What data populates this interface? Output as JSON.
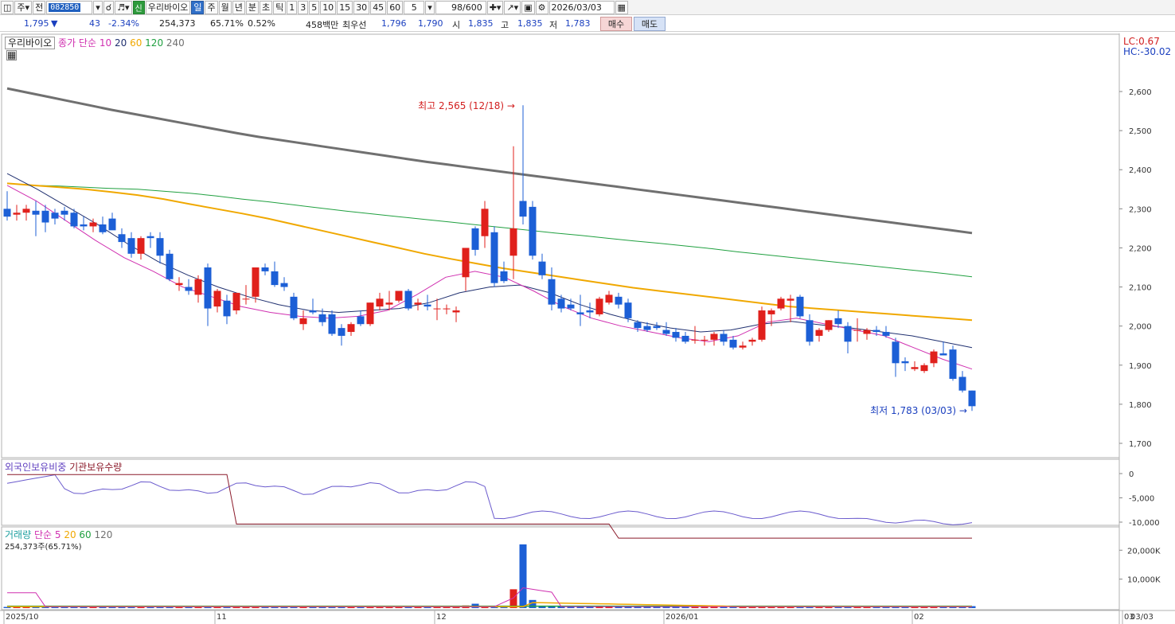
{
  "toolbar": {
    "market": "주",
    "kind": "전",
    "code": "082850",
    "badge": "신",
    "name": "우리바이오",
    "periods": [
      "일",
      "주",
      "월",
      "년",
      "분",
      "초",
      "틱"
    ],
    "active_period": "일",
    "minutes": [
      "1",
      "3",
      "5",
      "10",
      "15",
      "30",
      "45",
      "60"
    ],
    "interval": "5",
    "count": "98/600",
    "date": "2026/03/03"
  },
  "quote": {
    "price": "1,795",
    "arrow": "▼",
    "change": "43",
    "change_pct": "-2.34%",
    "volume": "254,373",
    "vol_ratio": "65.71%",
    "turnover": "0.52%",
    "amount": "458백만",
    "best_label": "최우선",
    "best_ask": "1,796",
    "best_bid": "1,790",
    "open_label": "시",
    "open": "1,835",
    "high_label": "고",
    "high": "1,835",
    "low_label": "저",
    "low": "1,783",
    "buy_label": "매수",
    "sell_label": "매도"
  },
  "price_panel": {
    "stock_label": "우리바이오",
    "ma_label": "종가 단순",
    "ma_periods": [
      "10",
      "20",
      "60",
      "120",
      "240"
    ],
    "lc_label": "LC:0.67",
    "hc_label": "HC:-30.02",
    "max_annotation": "최고 2,565 (12/18)",
    "min_annotation": "최저 1,783 (03/03)",
    "y_ticks": [
      "2,600",
      "2,500",
      "2,400",
      "2,300",
      "2,200",
      "2,100",
      "2,000",
      "1,900",
      "1,800",
      "1,700"
    ]
  },
  "foreign_panel": {
    "label1": "외국인보유비중",
    "label2": "기관보유수량",
    "y_ticks": [
      "0",
      "-5,000",
      "-10,000"
    ]
  },
  "volume_panel": {
    "label": "거래량",
    "ma_label": "단순 5",
    "ma_periods": [
      "20",
      "60",
      "120"
    ],
    "current": "254,373주(65.71%)",
    "y_ticks": [
      "20,000K",
      "10,000K"
    ]
  },
  "x_axis": {
    "labels": [
      "2025/10",
      "11",
      "12",
      "2026/01",
      "02",
      "03"
    ],
    "right_label": "03/03"
  },
  "colors": {
    "up": "#e0201c",
    "down": "#1c5fd6",
    "ma10": "#d030b0",
    "ma20": "#203070",
    "ma60": "#f0a800",
    "ma120": "#20a040",
    "ma240": "#707070"
  },
  "chart_data": {
    "type": "candlestick",
    "candles": [
      {
        "o": 2300,
        "h": 2345,
        "l": 2270,
        "c": 2280
      },
      {
        "o": 2285,
        "h": 2310,
        "l": 2270,
        "c": 2290
      },
      {
        "o": 2290,
        "h": 2310,
        "l": 2270,
        "c": 2300
      },
      {
        "o": 2295,
        "h": 2320,
        "l": 2230,
        "c": 2285
      },
      {
        "o": 2295,
        "h": 2310,
        "l": 2240,
        "c": 2265
      },
      {
        "o": 2290,
        "h": 2300,
        "l": 2260,
        "c": 2275
      },
      {
        "o": 2295,
        "h": 2305,
        "l": 2270,
        "c": 2285
      },
      {
        "o": 2290,
        "h": 2300,
        "l": 2250,
        "c": 2255
      },
      {
        "o": 2260,
        "h": 2280,
        "l": 2245,
        "c": 2255
      },
      {
        "o": 2255,
        "h": 2275,
        "l": 2240,
        "c": 2265
      },
      {
        "o": 2260,
        "h": 2280,
        "l": 2235,
        "c": 2240
      },
      {
        "o": 2275,
        "h": 2290,
        "l": 2260,
        "c": 2245
      },
      {
        "o": 2235,
        "h": 2250,
        "l": 2200,
        "c": 2215
      },
      {
        "o": 2225,
        "h": 2240,
        "l": 2175,
        "c": 2185
      },
      {
        "o": 2185,
        "h": 2230,
        "l": 2170,
        "c": 2225
      },
      {
        "o": 2230,
        "h": 2240,
        "l": 2200,
        "c": 2225
      },
      {
        "o": 2225,
        "h": 2240,
        "l": 2160,
        "c": 2180
      },
      {
        "o": 2185,
        "h": 2195,
        "l": 2115,
        "c": 2120
      },
      {
        "o": 2105,
        "h": 2125,
        "l": 2090,
        "c": 2110
      },
      {
        "o": 2100,
        "h": 2120,
        "l": 2080,
        "c": 2090
      },
      {
        "o": 2080,
        "h": 2130,
        "l": 2060,
        "c": 2120
      },
      {
        "o": 2150,
        "h": 2160,
        "l": 2000,
        "c": 2045
      },
      {
        "o": 2050,
        "h": 2095,
        "l": 2035,
        "c": 2090
      },
      {
        "o": 2065,
        "h": 2080,
        "l": 2005,
        "c": 2025
      },
      {
        "o": 2040,
        "h": 2085,
        "l": 2030,
        "c": 2085
      },
      {
        "o": 2070,
        "h": 2105,
        "l": 2055,
        "c": 2070
      },
      {
        "o": 2075,
        "h": 2150,
        "l": 2060,
        "c": 2150
      },
      {
        "o": 2150,
        "h": 2160,
        "l": 2130,
        "c": 2140
      },
      {
        "o": 2140,
        "h": 2165,
        "l": 2100,
        "c": 2105
      },
      {
        "o": 2110,
        "h": 2125,
        "l": 2090,
        "c": 2100
      },
      {
        "o": 2075,
        "h": 2085,
        "l": 2015,
        "c": 2020
      },
      {
        "o": 2005,
        "h": 2040,
        "l": 1990,
        "c": 2020
      },
      {
        "o": 2040,
        "h": 2070,
        "l": 2030,
        "c": 2035
      },
      {
        "o": 2030,
        "h": 2045,
        "l": 2000,
        "c": 2010
      },
      {
        "o": 2030,
        "h": 2040,
        "l": 1975,
        "c": 1980
      },
      {
        "o": 1995,
        "h": 2005,
        "l": 1950,
        "c": 1975
      },
      {
        "o": 1985,
        "h": 2010,
        "l": 1975,
        "c": 2005
      },
      {
        "o": 2025,
        "h": 2040,
        "l": 2000,
        "c": 2005
      },
      {
        "o": 2005,
        "h": 2060,
        "l": 2000,
        "c": 2060
      },
      {
        "o": 2050,
        "h": 2085,
        "l": 2040,
        "c": 2070
      },
      {
        "o": 2055,
        "h": 2090,
        "l": 2040,
        "c": 2060
      },
      {
        "o": 2065,
        "h": 2090,
        "l": 2060,
        "c": 2090
      },
      {
        "o": 2090,
        "h": 2095,
        "l": 2040,
        "c": 2045
      },
      {
        "o": 2055,
        "h": 2070,
        "l": 2040,
        "c": 2060
      },
      {
        "o": 2055,
        "h": 2080,
        "l": 2040,
        "c": 2050
      },
      {
        "o": 2045,
        "h": 2070,
        "l": 2015,
        "c": 2045
      },
      {
        "o": 2045,
        "h": 2055,
        "l": 2030,
        "c": 2045
      },
      {
        "o": 2035,
        "h": 2050,
        "l": 2010,
        "c": 2040
      },
      {
        "o": 2125,
        "h": 2170,
        "l": 2090,
        "c": 2200
      },
      {
        "o": 2250,
        "h": 2255,
        "l": 2180,
        "c": 2195
      },
      {
        "o": 2230,
        "h": 2320,
        "l": 2200,
        "c": 2300
      },
      {
        "o": 2240,
        "h": 2255,
        "l": 2100,
        "c": 2110
      },
      {
        "o": 2140,
        "h": 2165,
        "l": 2110,
        "c": 2115
      },
      {
        "o": 2180,
        "h": 2460,
        "l": 2120,
        "c": 2250
      },
      {
        "o": 2320,
        "h": 2565,
        "l": 2260,
        "c": 2280
      },
      {
        "o": 2305,
        "h": 2320,
        "l": 2170,
        "c": 2180
      },
      {
        "o": 2165,
        "h": 2185,
        "l": 2120,
        "c": 2130
      },
      {
        "o": 2120,
        "h": 2150,
        "l": 2040,
        "c": 2055
      },
      {
        "o": 2070,
        "h": 2080,
        "l": 2035,
        "c": 2045
      },
      {
        "o": 2055,
        "h": 2070,
        "l": 2040,
        "c": 2045
      },
      {
        "o": 2035,
        "h": 2080,
        "l": 2000,
        "c": 2030
      },
      {
        "o": 2040,
        "h": 2060,
        "l": 2020,
        "c": 2035
      },
      {
        "o": 2030,
        "h": 2075,
        "l": 2025,
        "c": 2070
      },
      {
        "o": 2060,
        "h": 2090,
        "l": 2055,
        "c": 2080
      },
      {
        "o": 2075,
        "h": 2085,
        "l": 2045,
        "c": 2055
      },
      {
        "o": 2060,
        "h": 2070,
        "l": 2010,
        "c": 2020
      },
      {
        "o": 2010,
        "h": 2015,
        "l": 1985,
        "c": 1995
      },
      {
        "o": 2000,
        "h": 2010,
        "l": 1985,
        "c": 1990
      },
      {
        "o": 2000,
        "h": 2010,
        "l": 1990,
        "c": 1995
      },
      {
        "o": 1990,
        "h": 2010,
        "l": 1975,
        "c": 1980
      },
      {
        "o": 1985,
        "h": 1995,
        "l": 1960,
        "c": 1970
      },
      {
        "o": 1975,
        "h": 1985,
        "l": 1955,
        "c": 1960
      },
      {
        "o": 1965,
        "h": 2000,
        "l": 1955,
        "c": 1965
      },
      {
        "o": 1965,
        "h": 1975,
        "l": 1950,
        "c": 1965
      },
      {
        "o": 1965,
        "h": 1985,
        "l": 1950,
        "c": 1980
      },
      {
        "o": 1980,
        "h": 1990,
        "l": 1950,
        "c": 1960
      },
      {
        "o": 1965,
        "h": 1975,
        "l": 1940,
        "c": 1945
      },
      {
        "o": 1945,
        "h": 1960,
        "l": 1940,
        "c": 1950
      },
      {
        "o": 1960,
        "h": 1970,
        "l": 1950,
        "c": 1965
      },
      {
        "o": 1965,
        "h": 2050,
        "l": 1960,
        "c": 2040
      },
      {
        "o": 2030,
        "h": 2045,
        "l": 2000,
        "c": 2040
      },
      {
        "o": 2045,
        "h": 2075,
        "l": 2040,
        "c": 2070
      },
      {
        "o": 2065,
        "h": 2080,
        "l": 2010,
        "c": 2070
      },
      {
        "o": 2075,
        "h": 2080,
        "l": 2020,
        "c": 2025
      },
      {
        "o": 2015,
        "h": 2030,
        "l": 1950,
        "c": 1960
      },
      {
        "o": 1975,
        "h": 1995,
        "l": 1960,
        "c": 1990
      },
      {
        "o": 1990,
        "h": 2015,
        "l": 1985,
        "c": 2015
      },
      {
        "o": 2020,
        "h": 2040,
        "l": 1995,
        "c": 2005
      },
      {
        "o": 2000,
        "h": 2010,
        "l": 1930,
        "c": 1960
      },
      {
        "o": 1990,
        "h": 2020,
        "l": 1960,
        "c": 1990
      },
      {
        "o": 1980,
        "h": 1995,
        "l": 1965,
        "c": 1990
      },
      {
        "o": 1990,
        "h": 2000,
        "l": 1975,
        "c": 1985
      },
      {
        "o": 1985,
        "h": 2000,
        "l": 1970,
        "c": 1975
      },
      {
        "o": 1960,
        "h": 1970,
        "l": 1870,
        "c": 1905
      },
      {
        "o": 1910,
        "h": 1920,
        "l": 1885,
        "c": 1905
      },
      {
        "o": 1890,
        "h": 1910,
        "l": 1885,
        "c": 1895
      },
      {
        "o": 1885,
        "h": 1905,
        "l": 1880,
        "c": 1900
      },
      {
        "o": 1905,
        "h": 1940,
        "l": 1895,
        "c": 1935
      },
      {
        "o": 1930,
        "h": 1960,
        "l": 1925,
        "c": 1925
      },
      {
        "o": 1940,
        "h": 1950,
        "l": 1860,
        "c": 1865
      },
      {
        "o": 1870,
        "h": 1885,
        "l": 1830,
        "c": 1835
      },
      {
        "o": 1835,
        "h": 1835,
        "l": 1783,
        "c": 1795
      }
    ],
    "ma240": [
      2608,
      2597,
      2586,
      2575,
      2564,
      2553,
      2543,
      2533,
      2523,
      2513,
      2503,
      2493,
      2484,
      2476,
      2468,
      2460,
      2452,
      2444,
      2436,
      2428,
      2420,
      2413,
      2406,
      2399,
      2392,
      2385,
      2378,
      2371,
      2364,
      2357,
      2350,
      2343,
      2336,
      2329,
      2322,
      2315,
      2308,
      2301,
      2294,
      2287,
      2280,
      2273,
      2266,
      2259,
      2252,
      2245,
      2238
    ],
    "ma240_start_index": 55,
    "ma120": [
      2365,
      2360,
      2358,
      2355,
      2352,
      2350,
      2345,
      2340,
      2333,
      2325,
      2318,
      2310,
      2302,
      2294,
      2287,
      2280,
      2273,
      2266,
      2259,
      2252,
      2245,
      2238,
      2232,
      2225,
      2218,
      2212,
      2205,
      2198,
      2190,
      2183,
      2176,
      2169,
      2162,
      2155,
      2148,
      2141,
      2134,
      2126
    ],
    "ma60": [
      2365,
      2360,
      2355,
      2350,
      2343,
      2335,
      2325,
      2312,
      2300,
      2288,
      2275,
      2260,
      2245,
      2230,
      2215,
      2200,
      2185,
      2172,
      2160,
      2148,
      2138,
      2128,
      2118,
      2108,
      2098,
      2090,
      2082,
      2074,
      2066,
      2058,
      2050,
      2045,
      2040,
      2035,
      2030,
      2025,
      2020,
      2015
    ],
    "ma20": [
      2390,
      2350,
      2305,
      2260,
      2210,
      2165,
      2130,
      2100,
      2075,
      2055,
      2040,
      2035,
      2040,
      2045,
      2060,
      2085,
      2100,
      2105,
      2085,
      2055,
      2030,
      2010,
      1995,
      1985,
      1990,
      2005,
      2012,
      2003,
      1995,
      1985,
      1975,
      1960,
      1945
    ],
    "ma10": [
      2360,
      2320,
      2270,
      2220,
      2175,
      2140,
      2100,
      2075,
      2050,
      2035,
      2025,
      2020,
      2025,
      2040,
      2080,
      2125,
      2140,
      2125,
      2090,
      2050,
      2020,
      2000,
      1985,
      1970,
      1960,
      1975,
      2010,
      2020,
      2005,
      1990,
      1975,
      1945,
      1915,
      1890
    ]
  }
}
